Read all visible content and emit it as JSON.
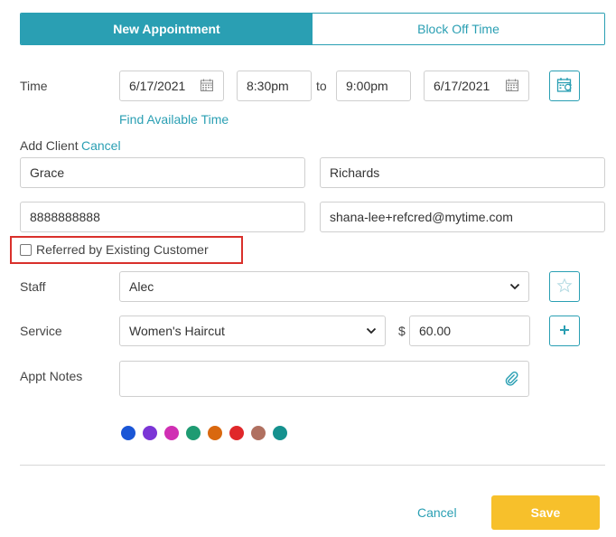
{
  "tabs": {
    "new_appointment": "New Appointment",
    "block_off_time": "Block Off Time"
  },
  "time": {
    "label": "Time",
    "start_date": "6/17/2021",
    "start_time": "8:30pm",
    "to_label": "to",
    "end_time": "9:00pm",
    "end_date": "6/17/2021",
    "find_available": "Find Available Time"
  },
  "client": {
    "label": "Add Client",
    "cancel": "Cancel",
    "first_name": "Grace",
    "last_name": "Richards",
    "phone": "8888888888",
    "email": "shana-lee+refcred@mytime.com",
    "referred_label": "Referred by Existing Customer",
    "referred_checked": false
  },
  "staff": {
    "label": "Staff",
    "selected": "Alec"
  },
  "service": {
    "label": "Service",
    "selected": "Women's Haircut",
    "currency": "$",
    "price": "60.00"
  },
  "notes": {
    "label": "Appt Notes",
    "value": ""
  },
  "colors": [
    "#1a56d6",
    "#7b35d6",
    "#d02fb3",
    "#1e9b72",
    "#d9680f",
    "#e0272a",
    "#b07060",
    "#15918e"
  ],
  "footer": {
    "cancel": "Cancel",
    "save": "Save"
  },
  "theme": {
    "accent": "#2a9fb3",
    "save": "#f7c02b",
    "highlight": "#d9302b"
  }
}
